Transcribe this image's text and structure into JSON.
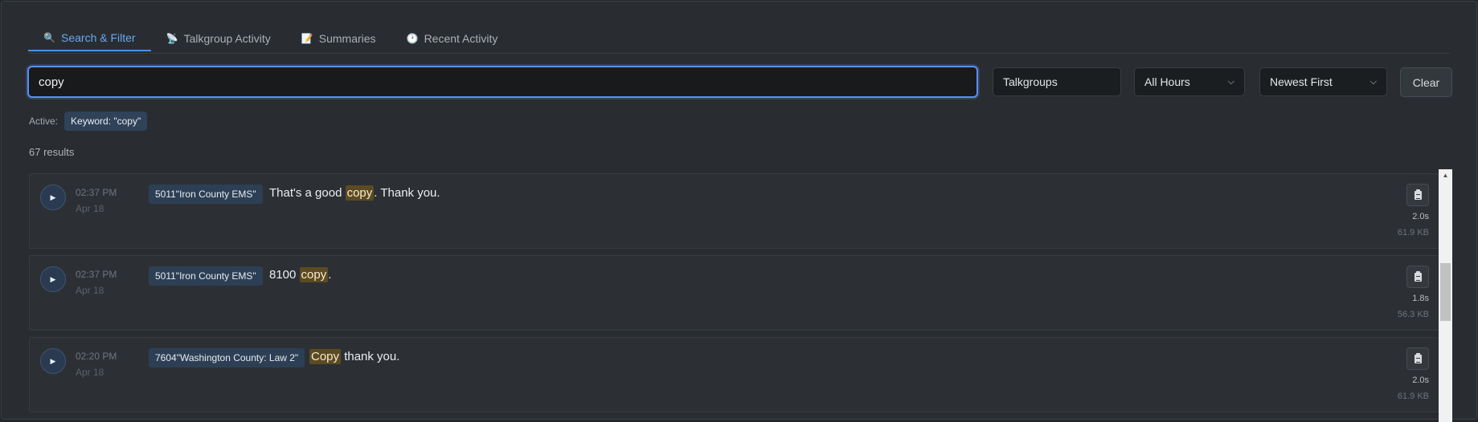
{
  "tabs": [
    {
      "label": "Search & Filter",
      "icon": "search-icon",
      "glyph": "🔍",
      "active": true
    },
    {
      "label": "Talkgroup Activity",
      "icon": "satellite-icon",
      "glyph": "📡",
      "active": false
    },
    {
      "label": "Summaries",
      "icon": "memo-icon",
      "glyph": "📝",
      "active": false
    },
    {
      "label": "Recent Activity",
      "icon": "clock-icon",
      "glyph": "🕐",
      "active": false
    }
  ],
  "filters": {
    "search_value": "copy",
    "talkgroups_label": "Talkgroups",
    "hours_value": "All Hours",
    "sort_value": "Newest First",
    "clear_label": "Clear"
  },
  "active": {
    "label": "Active:",
    "chip": "Keyword: \"copy\""
  },
  "results_count": "67 results",
  "results": [
    {
      "time": "02:37 PM",
      "date": "Apr 18",
      "talkgroup": "5011\"Iron County EMS\"",
      "text_before": "That's a good ",
      "highlight": "copy",
      "text_after": ". Thank you.",
      "duration": "2.0s",
      "size": "61.9 KB"
    },
    {
      "time": "02:37 PM",
      "date": "Apr 18",
      "talkgroup": "5011\"Iron County EMS\"",
      "text_before": "8100 ",
      "highlight": "copy",
      "text_after": ".",
      "duration": "1.8s",
      "size": "56.3 KB"
    },
    {
      "time": "02:20 PM",
      "date": "Apr 18",
      "talkgroup": "7604\"Washington County: Law 2\"",
      "text_before": "",
      "highlight": "Copy",
      "text_after": " thank you.",
      "duration": "2.0s",
      "size": "61.9 KB"
    }
  ],
  "colors": {
    "accent": "#4d8fe6",
    "highlight_bg": "#5c4a22",
    "chip_bg": "#2f4258",
    "panel_bg": "#292d31"
  }
}
